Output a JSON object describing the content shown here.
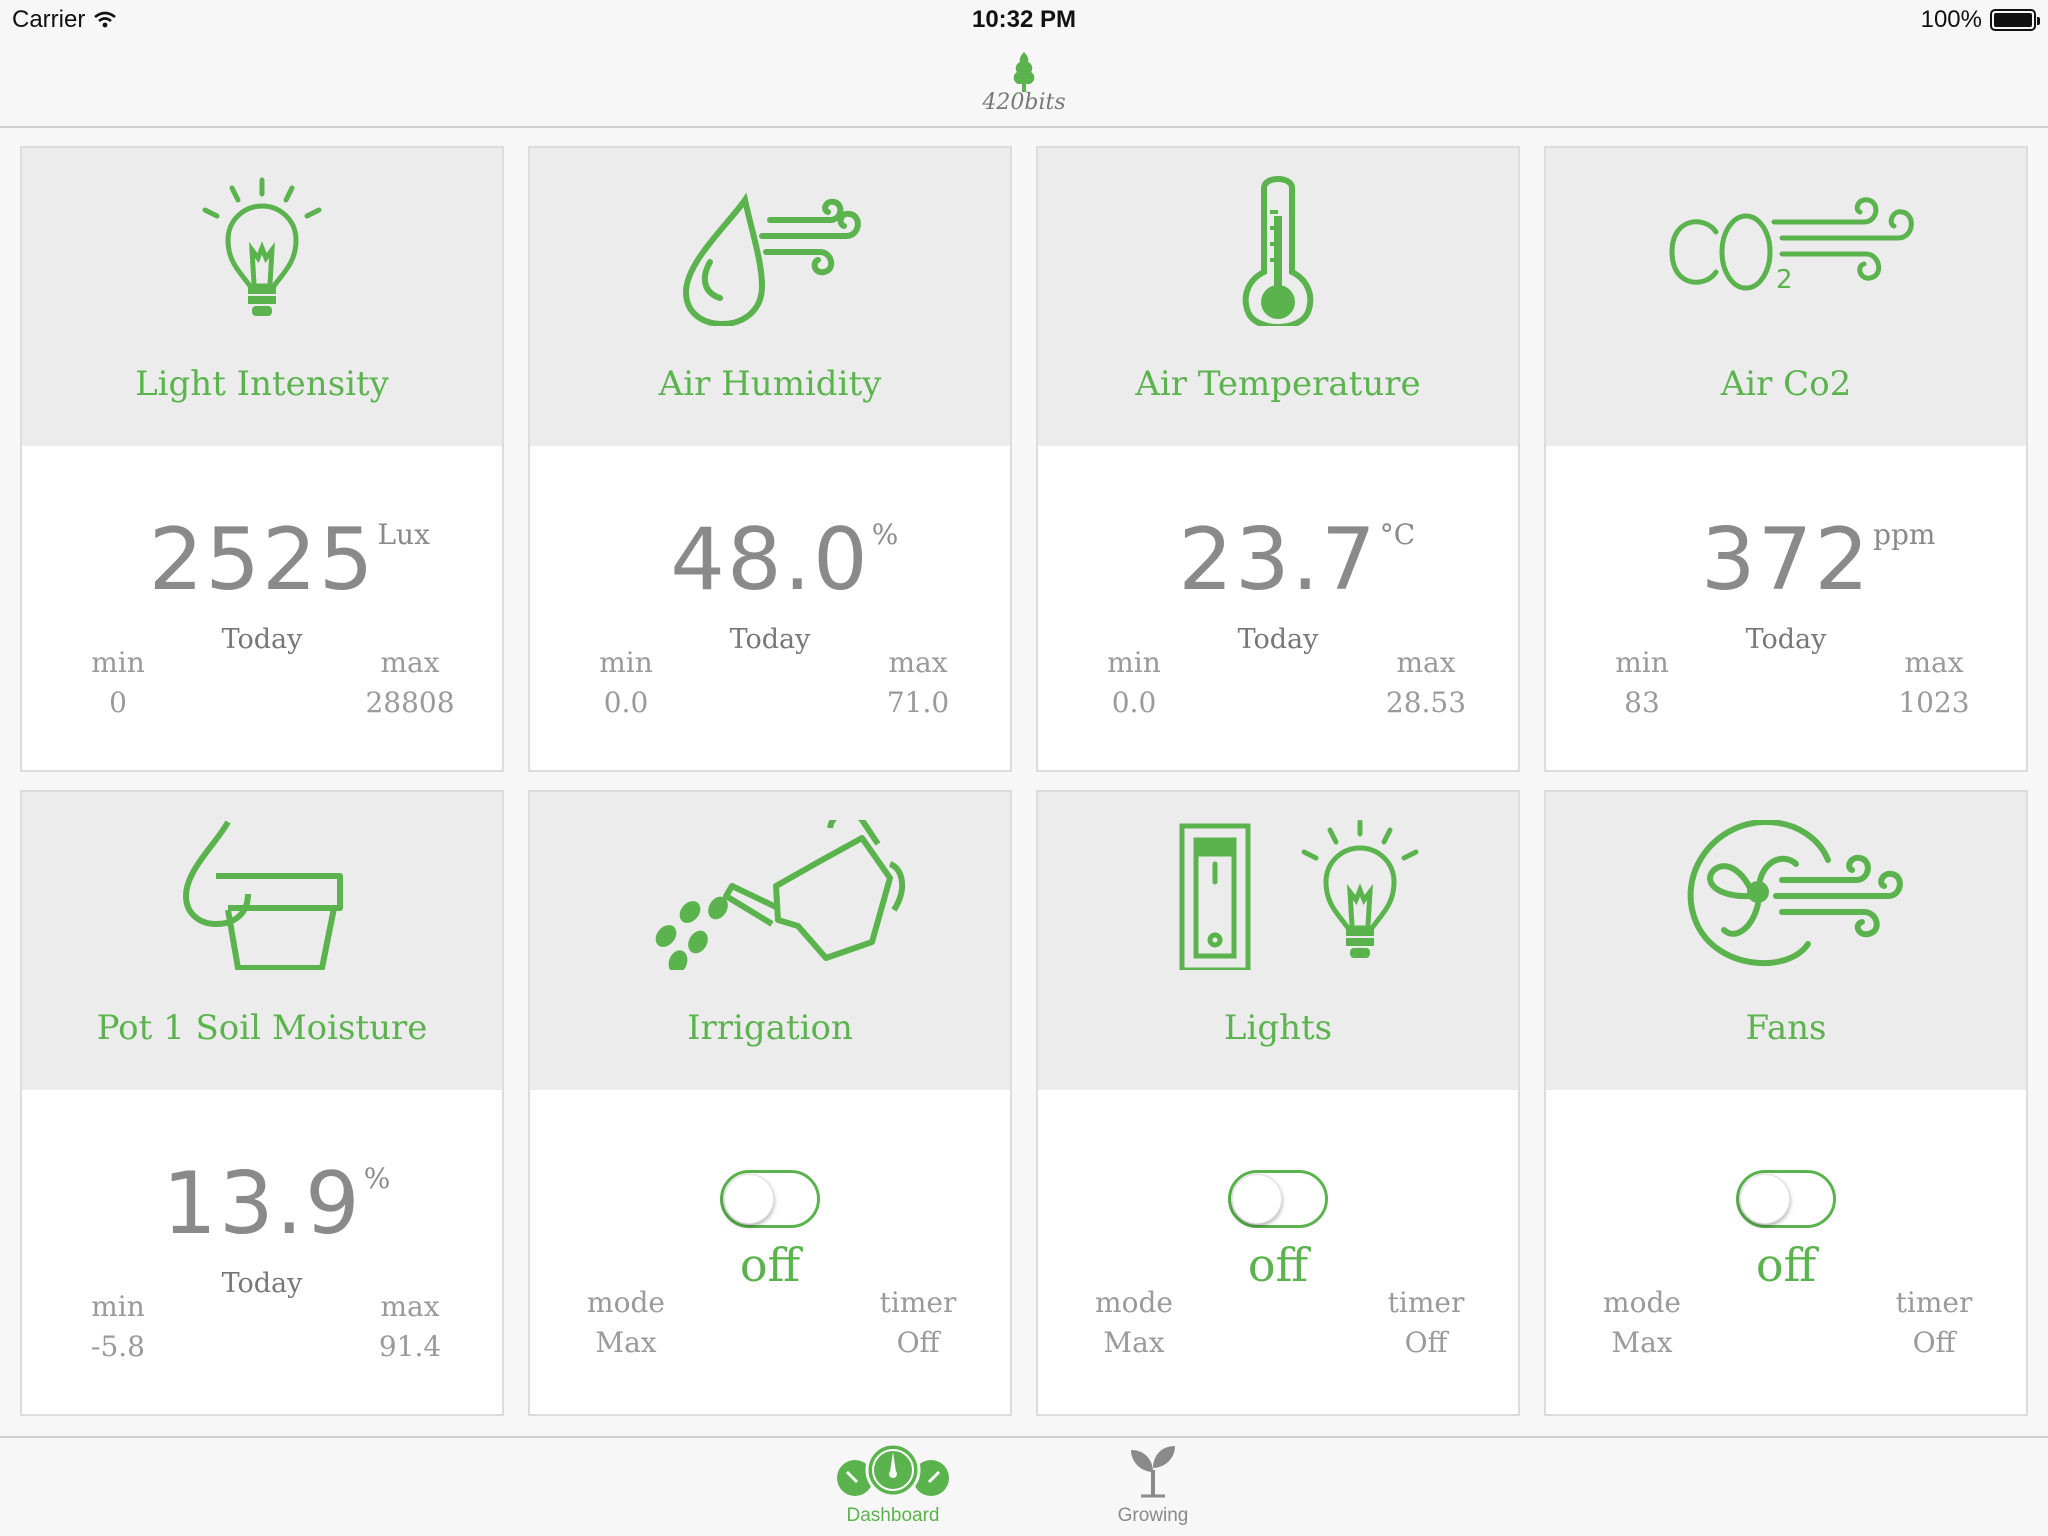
{
  "status_bar": {
    "carrier": "Carrier",
    "time": "10:32 PM",
    "battery": "100%"
  },
  "nav": {
    "brand": "420bits"
  },
  "colors": {
    "accent": "#5bb34e",
    "tile_header_bg": "#ececec",
    "text_gray": "#8a8a8a"
  },
  "sensors": [
    {
      "title": "Light Intensity",
      "icon": "lightbulb-icon",
      "value": "2525",
      "unit": "Lux",
      "today_label": "Today",
      "min_label": "min",
      "min": "0",
      "max_label": "max",
      "max": "28808"
    },
    {
      "title": "Air Humidity",
      "icon": "humidity-icon",
      "value": "48.0",
      "unit": "%",
      "today_label": "Today",
      "min_label": "min",
      "min": "0.0",
      "max_label": "max",
      "max": "71.0"
    },
    {
      "title": "Air Temperature",
      "icon": "thermometer-icon",
      "value": "23.7",
      "unit": "°C",
      "today_label": "Today",
      "min_label": "min",
      "min": "0.0",
      "max_label": "max",
      "max": "28.53"
    },
    {
      "title": "Air Co2",
      "icon": "co2-icon",
      "value": "372",
      "unit": "ppm",
      "today_label": "Today",
      "min_label": "min",
      "min": "83",
      "max_label": "max",
      "max": "1023"
    },
    {
      "title": "Pot 1 Soil Moisture",
      "icon": "soil-moisture-icon",
      "value": "13.9",
      "unit": "%",
      "today_label": "Today",
      "min_label": "min",
      "min": "-5.8",
      "max_label": "max",
      "max": "91.4"
    }
  ],
  "controls": [
    {
      "title": "Irrigation",
      "icon": "watering-can-icon",
      "state": "off",
      "mode_label": "mode",
      "mode": "Max",
      "timer_label": "timer",
      "timer": "Off"
    },
    {
      "title": "Lights",
      "icon": "light-switch-icon",
      "state": "off",
      "mode_label": "mode",
      "mode": "Max",
      "timer_label": "timer",
      "timer": "Off"
    },
    {
      "title": "Fans",
      "icon": "fan-icon",
      "state": "off",
      "mode_label": "mode",
      "mode": "Max",
      "timer_label": "timer",
      "timer": "Off"
    }
  ],
  "tabs": [
    {
      "label": "Dashboard",
      "icon": "gauges-icon",
      "selected": true
    },
    {
      "label": "Growing",
      "icon": "sprout-icon",
      "selected": false
    }
  ]
}
